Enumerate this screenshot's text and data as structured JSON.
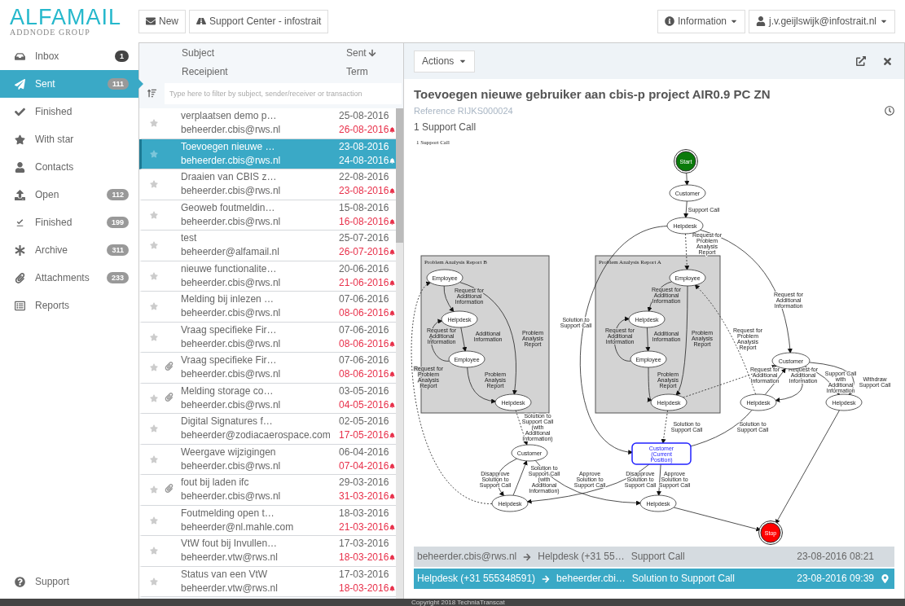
{
  "header": {
    "logo": "ALFAMAIL",
    "logo_sub": "ADDNODE GROUP",
    "buttons": [
      {
        "label": "New",
        "kind": "mail"
      },
      {
        "label": "Support Center - infostrait",
        "kind": "road"
      }
    ],
    "menus": [
      {
        "label": "Information",
        "kind": "info"
      },
      {
        "label": "j.v.geijlswijk@infostrait.nl",
        "kind": "user"
      }
    ]
  },
  "sidebar": {
    "items": [
      {
        "label": "Inbox",
        "kind": "inbox",
        "badge": "1",
        "unread": true,
        "selected": false
      },
      {
        "label": "Sent",
        "kind": "sent",
        "badge": "111",
        "unread": false,
        "selected": true
      },
      {
        "label": "Finished",
        "kind": "check",
        "selected": false
      },
      {
        "label": "With star",
        "kind": "star",
        "selected": false
      },
      {
        "label": "Contacts",
        "kind": "user",
        "selected": false
      },
      {
        "label": "Open",
        "kind": "upload",
        "badge": "112",
        "unread": false,
        "selected": false
      },
      {
        "label": "Finished",
        "kind": "done",
        "badge": "199",
        "unread": false,
        "selected": false
      },
      {
        "label": "Archive",
        "kind": "asterisk",
        "badge": "311",
        "unread": false,
        "selected": false
      },
      {
        "label": "Attachments",
        "kind": "clip",
        "badge": "233",
        "unread": false,
        "selected": false
      },
      {
        "label": "Reports",
        "kind": "report",
        "selected": false
      }
    ],
    "footer": {
      "label": "Support"
    }
  },
  "list": {
    "columns": [
      "Subject",
      "Sent",
      "Receipient",
      "Term"
    ],
    "filter_placeholder": "Type here to filter by subject, sender/receiver or transaction",
    "rows": [
      {
        "subject": "verplaatsen demo p…",
        "sent": "25-08-2016",
        "recipient": "beheerder.cbis@rws.nl",
        "term": "26-08-2016",
        "overdue": true,
        "attachment": false,
        "starred": false,
        "selected": false
      },
      {
        "subject": "Toevoegen nieuwe …",
        "sent": "23-08-2016",
        "recipient": "beheerder.cbis@rws.nl",
        "term": "24-08-2016",
        "overdue": true,
        "attachment": false,
        "starred": false,
        "selected": true
      },
      {
        "subject": "Draaien van CBIS z…",
        "sent": "22-08-2016",
        "recipient": "beheerder.cbis@rws.nl",
        "term": "23-08-2016",
        "overdue": true,
        "attachment": false,
        "starred": false,
        "selected": false
      },
      {
        "subject": "Geoweb foutmeldin…",
        "sent": "15-08-2016",
        "recipient": "beheerder.cbis@rws.nl",
        "term": "16-08-2016",
        "overdue": true,
        "attachment": false,
        "starred": false,
        "selected": false
      },
      {
        "subject": "test",
        "sent": "25-07-2016",
        "recipient": "beheerder@alfamail.nl",
        "term": "26-07-2016",
        "overdue": true,
        "attachment": false,
        "starred": false,
        "selected": false
      },
      {
        "subject": "nieuwe functionalite…",
        "sent": "20-06-2016",
        "recipient": "beheerder.cbis@rws.nl",
        "term": "21-06-2016",
        "overdue": true,
        "attachment": false,
        "starred": false,
        "selected": false
      },
      {
        "subject": "Melding bij inlezen …",
        "sent": "07-06-2016",
        "recipient": "beheerder.cbis@rws.nl",
        "term": "08-06-2016",
        "overdue": true,
        "attachment": false,
        "starred": false,
        "selected": false
      },
      {
        "subject": "Vraag specifieke Fir…",
        "sent": "07-06-2016",
        "recipient": "beheerder.cbis@rws.nl",
        "term": "08-06-2016",
        "overdue": true,
        "attachment": false,
        "starred": false,
        "selected": false
      },
      {
        "subject": "Vraag specifieke Fir…",
        "sent": "07-06-2016",
        "recipient": "beheerder.cbis@rws.nl",
        "term": "08-06-2016",
        "overdue": true,
        "attachment": true,
        "starred": false,
        "selected": false
      },
      {
        "subject": "Melding storage co…",
        "sent": "03-05-2016",
        "recipient": "beheerder.cbis@rws.nl",
        "term": "04-05-2016",
        "overdue": true,
        "attachment": true,
        "starred": false,
        "selected": false
      },
      {
        "subject": "Digital Signatures f…",
        "sent": "02-05-2016",
        "recipient": "beheerder@zodiacaerospace.com",
        "term": "17-05-2016",
        "overdue": true,
        "attachment": false,
        "starred": false,
        "selected": false
      },
      {
        "subject": "Weergave wijzigingen",
        "sent": "06-04-2016",
        "recipient": "beheerder.cbis@rws.nl",
        "term": "07-04-2016",
        "overdue": true,
        "attachment": false,
        "starred": false,
        "selected": false
      },
      {
        "subject": "fout bij laden ifc",
        "sent": "29-03-2016",
        "recipient": "beheerder.cbis@rws.nl",
        "term": "31-03-2016",
        "overdue": true,
        "attachment": true,
        "starred": false,
        "selected": false
      },
      {
        "subject": "Foutmelding open t…",
        "sent": "18-03-2016",
        "recipient": "beheerder@nl.mahle.com",
        "term": "21-03-2016",
        "overdue": true,
        "attachment": false,
        "starred": false,
        "selected": false
      },
      {
        "subject": "VtW fout bij Invullen…",
        "sent": "17-03-2016",
        "recipient": "beheerder.vtw@rws.nl",
        "term": "18-03-2016",
        "overdue": true,
        "attachment": false,
        "starred": false,
        "selected": false
      },
      {
        "subject": "Status van een VtW",
        "sent": "17-03-2016",
        "recipient": "beheerder.vtw@rws.nl",
        "term": "18-03-2016",
        "overdue": true,
        "attachment": false,
        "starred": false,
        "selected": false
      }
    ]
  },
  "detail": {
    "actions": "Actions",
    "title": "Toevoegen nieuwe gebruiker aan cbis-p project AIR0.9 PC ZN",
    "reference": "Reference RIJKS000024",
    "subtitle": "1 Support Call",
    "diagram": {
      "caption": "1 Support Call",
      "clusters": [
        {
          "title": "Problem Analysis Report B"
        },
        {
          "title": "Problem Analysis Report A"
        }
      ],
      "nodes": [
        {
          "label": "Start",
          "kind": "start"
        },
        {
          "label": "Customer",
          "kind": "state"
        },
        {
          "label": "Helpdesk",
          "kind": "state"
        },
        {
          "label": "Employee",
          "kind": "state"
        },
        {
          "label": "Helpdesk",
          "kind": "state"
        },
        {
          "label": "Employee",
          "kind": "state"
        },
        {
          "label": "Helpdesk",
          "kind": "state"
        },
        {
          "label": "Employee",
          "kind": "state"
        },
        {
          "label": "Helpdesk",
          "kind": "state"
        },
        {
          "label": "Employee",
          "kind": "state"
        },
        {
          "label": "Helpdesk",
          "kind": "state"
        },
        {
          "label": "Customer",
          "kind": "state"
        },
        {
          "label": "Helpdesk",
          "kind": "state"
        },
        {
          "label": "Helpdesk",
          "kind": "state"
        },
        {
          "label": "Customer",
          "kind": "state"
        },
        {
          "label": "Customer (Current Position)",
          "kind": "current"
        },
        {
          "label": "Helpdesk",
          "kind": "state"
        },
        {
          "label": "Helpdesk",
          "kind": "state"
        },
        {
          "label": "Stop",
          "kind": "end"
        }
      ],
      "edges": [
        {
          "dashed": false
        },
        {
          "label": "Support Call",
          "dashed": false
        },
        {
          "label": "Request for Problem Analysis Report",
          "dashed": true
        },
        {
          "label": "Request for Additional Information",
          "dashed": false
        },
        {
          "label": "Solution to Support Call",
          "dashed": false
        },
        {
          "label": "Request for Additional Information",
          "dashed": false
        },
        {
          "label": "Request for Additional Information",
          "dashed": false
        },
        {
          "label": "Additional Information",
          "dashed": false
        },
        {
          "label": "Problem Analysis Report",
          "dashed": false
        },
        {
          "label": "Problem Analysis Report",
          "dashed": false
        },
        {
          "label": "Request for Additional Information",
          "dashed": false
        },
        {
          "label": "Request for Additional Information",
          "dashed": false
        },
        {
          "label": "Additional Information",
          "dashed": false
        },
        {
          "label": "Problem Analysis Report",
          "dashed": false
        },
        {
          "label": "Problem Analysis Report",
          "dashed": false
        },
        {
          "dashed": true
        },
        {
          "label": "Request for Problem Analysis Report",
          "dashed": true
        },
        {
          "label": "Request for Additional Information",
          "dashed": false
        },
        {
          "label": "Request for Additional Information",
          "dashed": false
        },
        {
          "label": "Support Call with Additional Information",
          "dashed": false
        },
        {
          "label": "Withdraw Support Call",
          "dashed": false
        },
        {
          "dashed": false
        },
        {
          "label": "Solution to Support Call (with Additional Information)",
          "dashed": true
        },
        {
          "label": "Solution to Support Call",
          "dashed": true
        },
        {
          "label": "Solution to Support Call",
          "dashed": false
        },
        {
          "label": "Disapprove Solution to Support Call",
          "dashed": false
        },
        {
          "label": "Solution to Support Call (with Additional Information)",
          "dashed": false
        },
        {
          "label": "Approve Solution to Support Call",
          "dashed": false
        },
        {
          "label": "Disapprove Solution to Support Call",
          "dashed": false
        },
        {
          "label": "Approve Solution to Support Call",
          "dashed": false
        },
        {
          "dashed": false
        },
        {
          "label": "Request for Problem Analysis Report",
          "dashed": true
        }
      ]
    },
    "messages": [
      {
        "from": "beheerder.cbis@rws.nl",
        "to": "Helpdesk (+31 55…",
        "subject": "Support Call",
        "time": "23-08-2016 08:21",
        "selected": false,
        "current": false
      },
      {
        "from": "Helpdesk (+31 555348591)",
        "to": "beheerder.cbi…",
        "subject": "Solution to Support Call",
        "time": "23-08-2016 09:39",
        "selected": true,
        "current": true
      }
    ]
  },
  "footer": {
    "text": "Copyright 2018 TechniaTranscat"
  }
}
